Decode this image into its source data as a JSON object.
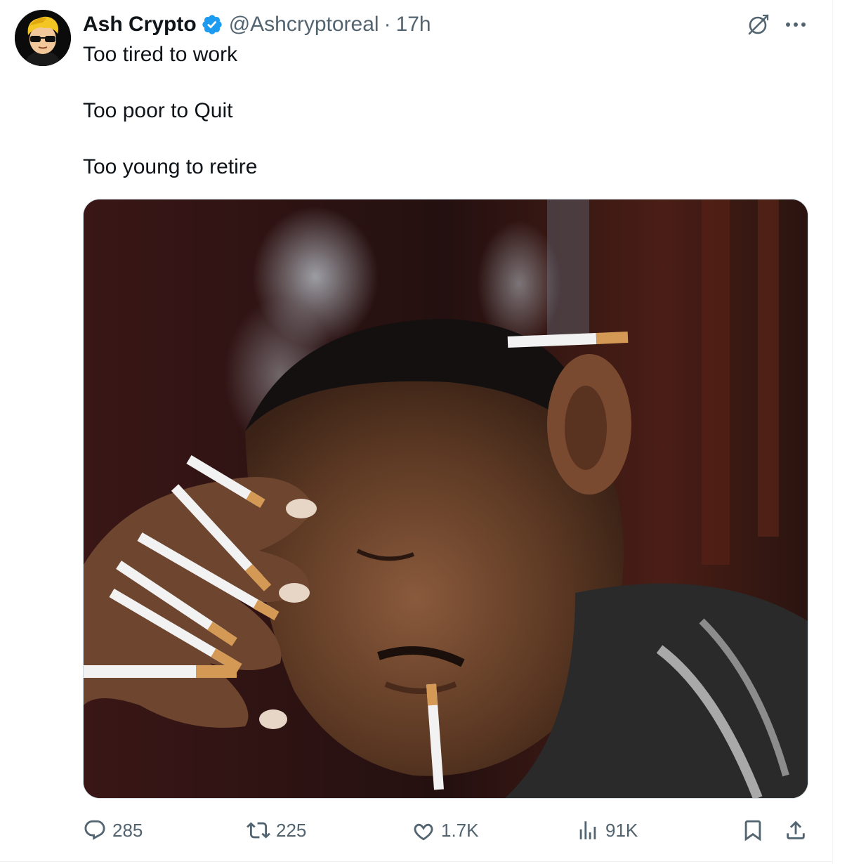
{
  "author": {
    "display_name": "Ash Crypto",
    "handle": "@Ashcryptoreal",
    "separator": "·",
    "time": "17h",
    "verified": true,
    "avatar_icon": "cartoon-avatar-sunglasses"
  },
  "tweet": {
    "lines": [
      "Too tired to work",
      "Too poor to Quit",
      "Too young to retire"
    ],
    "media_icon": "photo-man-with-cigarettes"
  },
  "actions": {
    "replies": "285",
    "reposts": "225",
    "likes": "1.7K",
    "views": "91K"
  },
  "colors": {
    "text": "#0f1419",
    "muted": "#536471",
    "verified_blue": "#1d9bf0",
    "border": "#cfd9de"
  }
}
